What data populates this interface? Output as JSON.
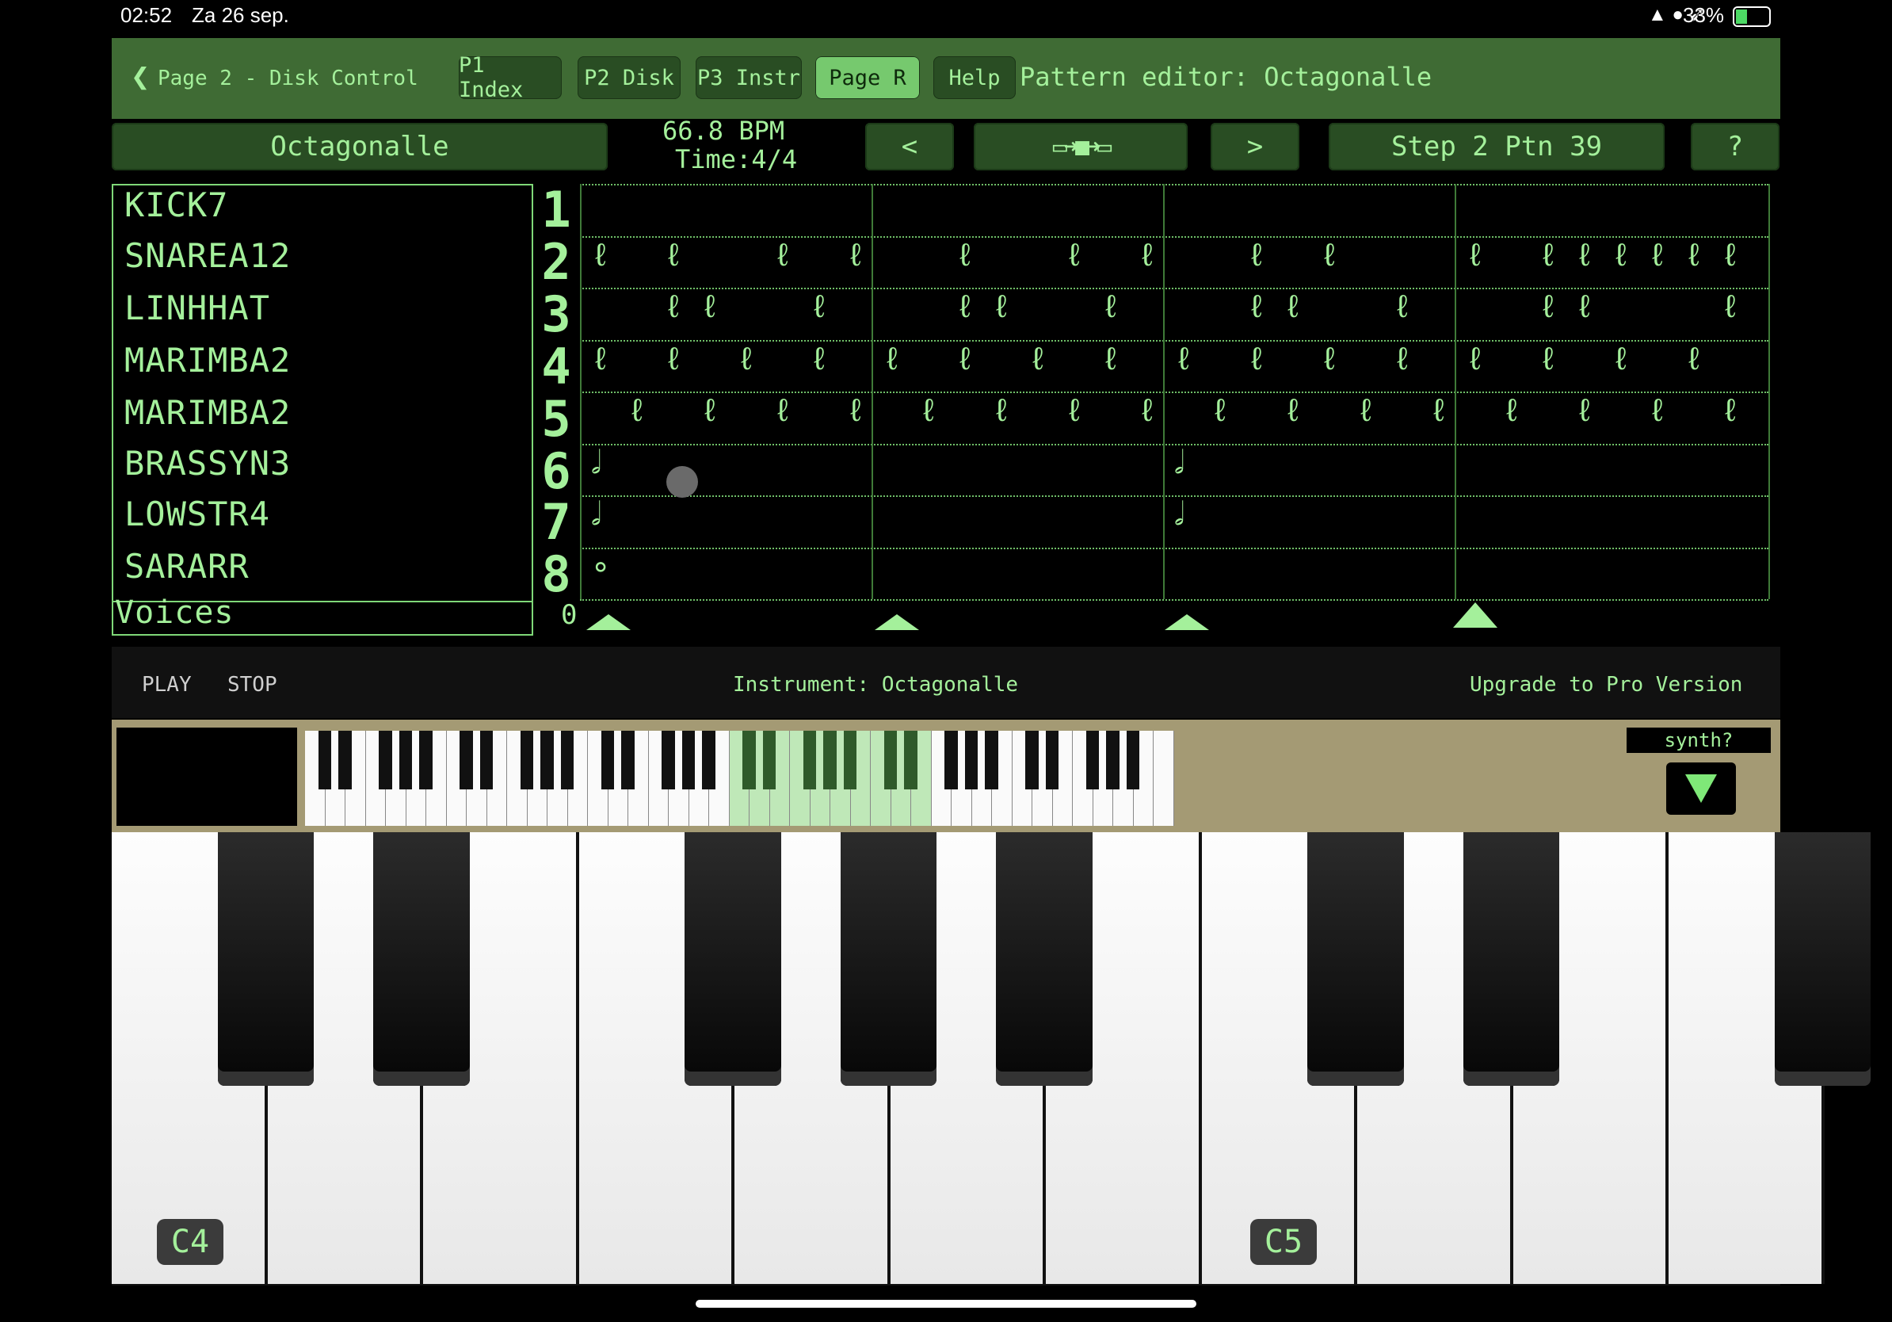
{
  "status": {
    "time": "02:52",
    "date": "Za 26 sep.",
    "battery": "33%"
  },
  "header": {
    "back_label": "Page 2 - Disk Control",
    "tabs": [
      "P1 Index",
      "P2 Disk",
      "P3 Instr",
      "Page R",
      "Help"
    ],
    "active_tab": "Page R",
    "title": "Pattern editor: Octagonalle"
  },
  "controls": {
    "pattern_name": "Octagonalle",
    "bpm": "66.8 BPM",
    "time_sig": "Time:4/4",
    "prev": "<",
    "next": ">",
    "step": "Step 2 Ptn 39",
    "help": "?"
  },
  "voices": {
    "items": [
      "KICK7",
      "SNAREA12",
      "LINHHAT",
      "MARIMBA2",
      "MARIMBA2",
      "BRASSYN3",
      "LOWSTR4",
      "SARARR"
    ],
    "footer": "Voices",
    "numbers": [
      "1",
      "2",
      "3",
      "4",
      "5",
      "6",
      "7",
      "8"
    ],
    "zero": "0"
  },
  "transport": {
    "play": "PLAY",
    "stop": "STOP",
    "instrument": "Instrument: Octagonalle",
    "upgrade": "Upgrade to Pro Version"
  },
  "keyboard": {
    "synth_label": "synth?",
    "octave_labels": [
      "C4",
      "C5"
    ]
  },
  "colors": {
    "accent": "#a4f09b",
    "panel": "#3f6b34",
    "button": "#294d23"
  }
}
